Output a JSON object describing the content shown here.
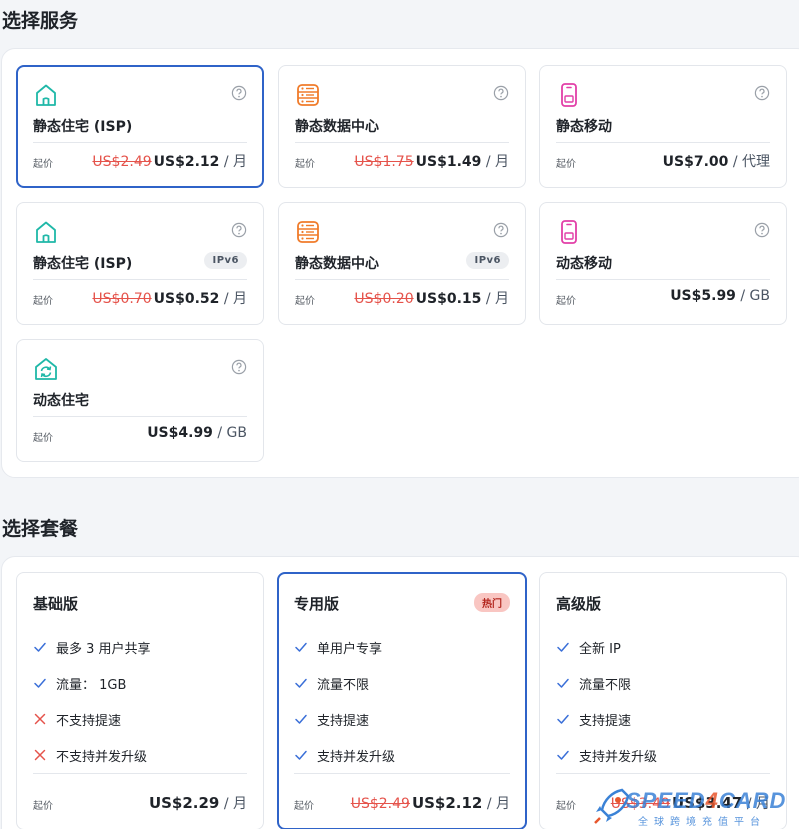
{
  "services_title": "选择服务",
  "plans_title": "选择套餐",
  "colors": {
    "selected_border": "#2f63c8",
    "old_price": "#e5534b",
    "isp_icon": "#1fb8a8",
    "datacenter_icon": "#f07b2a",
    "mobile_icon": "#e23fa8",
    "hot_badge": "#f9c6c2"
  },
  "services": [
    {
      "icon": "house-icon",
      "name": "静态住宅 (ISP)",
      "tag": "",
      "from": "起价",
      "old": "US$2.49",
      "new": "US$2.12",
      "unit": " / 月",
      "selected": true
    },
    {
      "icon": "server-icon",
      "name": "静态数据中心",
      "tag": "",
      "from": "起价",
      "old": "US$1.75",
      "new": "US$1.49",
      "unit": " / 月",
      "selected": false
    },
    {
      "icon": "phone-icon",
      "name": "静态移动",
      "tag": "",
      "from": "起价",
      "old": "",
      "new": "US$7.00",
      "unit": " / 代理",
      "selected": false
    },
    {
      "icon": "house-icon",
      "name": "静态住宅 (ISP)",
      "tag": "IPv6",
      "from": "起价",
      "old": "US$0.70",
      "new": "US$0.52",
      "unit": " / 月",
      "selected": false
    },
    {
      "icon": "server-icon",
      "name": "静态数据中心",
      "tag": "IPv6",
      "from": "起价",
      "old": "US$0.20",
      "new": "US$0.15",
      "unit": " / 月",
      "selected": false
    },
    {
      "icon": "phone-icon",
      "name": "动态移动",
      "tag": "",
      "from": "起价",
      "old": "",
      "new": "US$5.99",
      "unit": " / GB",
      "selected": false
    },
    {
      "icon": "refresh-house-icon",
      "name": "动态住宅",
      "tag": "",
      "from": "起价",
      "old": "",
      "new": "US$4.99",
      "unit": " / GB",
      "selected": false
    }
  ],
  "plans": [
    {
      "name": "基础版",
      "badge": "",
      "features": [
        {
          "ok": true,
          "text": "最多 3 用户共享"
        },
        {
          "ok": true,
          "text": "流量： 1GB"
        },
        {
          "ok": false,
          "text": "不支持提速"
        },
        {
          "ok": false,
          "text": "不支持并发升级"
        }
      ],
      "from": "起价",
      "old": "",
      "new": "US$2.29",
      "unit": " / 月",
      "selected": false
    },
    {
      "name": "专用版",
      "badge": "热门",
      "features": [
        {
          "ok": true,
          "text": "单用户专享"
        },
        {
          "ok": true,
          "text": "流量不限"
        },
        {
          "ok": true,
          "text": "支持提速"
        },
        {
          "ok": true,
          "text": "支持并发升级"
        }
      ],
      "from": "起价",
      "old": "US$2.49",
      "new": "US$2.12",
      "unit": " / 月",
      "selected": true
    },
    {
      "name": "高级版",
      "badge": "",
      "features": [
        {
          "ok": true,
          "text": "全新 IP"
        },
        {
          "ok": true,
          "text": "流量不限"
        },
        {
          "ok": true,
          "text": "支持提速"
        },
        {
          "ok": true,
          "text": "支持并发升级"
        }
      ],
      "from": "起价",
      "old": "US$3.49",
      "new": "US$3.47",
      "unit": " / 月",
      "selected": false
    }
  ],
  "watermark": {
    "brand_a": "SPEED",
    "brand_b": "4",
    "brand_c": "CARD",
    "sub": "全球跨境充值平台"
  }
}
